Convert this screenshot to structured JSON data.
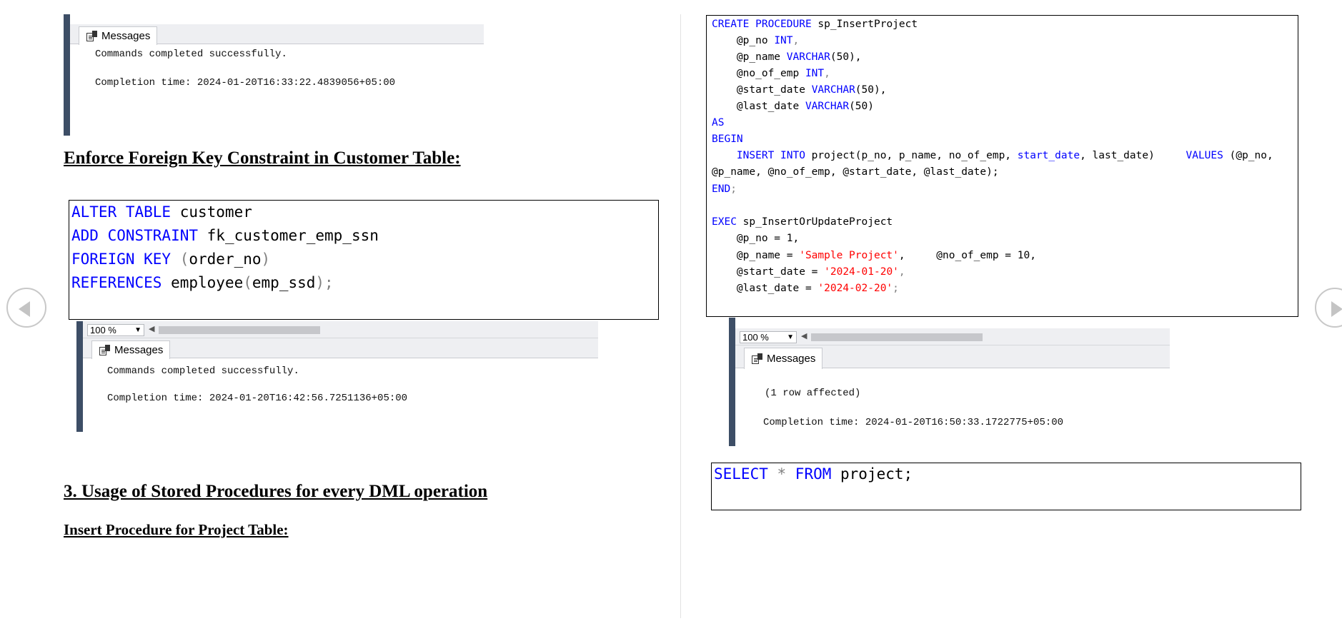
{
  "left": {
    "top_result": {
      "tab_label": "Messages",
      "line1": "Commands completed successfully.",
      "line2": "Completion time: 2024-01-20T16:33:22.4839056+05:00"
    },
    "heading_fk": "Enforce Foreign Key Constraint in Customer Table:",
    "alter_code": {
      "line1_kw": "ALTER TABLE",
      "line1_rest": " customer",
      "line2_kw": "ADD CONSTRAINT",
      "line2_rest": " fk_customer_emp_ssn",
      "line3_kw": "FOREIGN KEY",
      "line3_open": " (",
      "line3_col": "order_no",
      "line3_close": ")",
      "line4_kw": "REFERENCES",
      "line4_tbl": " employee",
      "line4_open": "(",
      "line4_col": "emp_ssd",
      "line4_close": ");"
    },
    "fk_result": {
      "zoom": "100 %",
      "tab_label": "Messages",
      "line1": "Commands completed successfully.",
      "line2": "Completion time: 2024-01-20T16:42:56.7251136+05:00"
    },
    "heading_sp": "3. Usage of Stored Procedures for every DML operation",
    "heading_insert": "Insert Procedure for Project Table:"
  },
  "right": {
    "proc_code": {
      "l1_kw": "CREATE PROCEDURE",
      "l1_rest": " sp_InsertProject",
      "l2_param": "    @p_no ",
      "l2_type": "INT",
      "l2_end": ",",
      "l3_param": "    @p_name ",
      "l3_type": "VARCHAR",
      "l3_end": "(50),",
      "l4_param": "    @no_of_emp ",
      "l4_type": "INT",
      "l4_end": ",",
      "l5_param": "    @start_date ",
      "l5_type": "VARCHAR",
      "l5_end": "(50),",
      "l6_param": "    @last_date ",
      "l6_type": "VARCHAR",
      "l6_end": "(50)",
      "l7_kw": "AS",
      "l8_kw": "BEGIN",
      "l9_kw": "    INSERT INTO",
      "l9_a": " project(p_no, p_name, no_of_emp, ",
      "l9_kw2": "start_date",
      "l9_b": ", last_date)     ",
      "l9_kw3": "VALUES",
      "l9_c": " (@p_no,",
      "l10": "@p_name, @no_of_emp, @start_date, @last_date);",
      "l11_kw": "END",
      "l11_end": ";",
      "l13_kw": "EXEC",
      "l13_rest": " sp_InsertOrUpdateProject",
      "l14": "    @p_no = 1,",
      "l15_a": "    @p_name = ",
      "l15_str": "'Sample Project'",
      "l15_b": ",     @no_of_emp = 10,",
      "l16_a": "    @start_date = ",
      "l16_str": "'2024-01-20'",
      "l16_b": ",",
      "l17_a": "    @last_date = ",
      "l17_str": "'2024-02-20'",
      "l17_b": ";"
    },
    "insert_result": {
      "zoom": "100 %",
      "tab_label": "Messages",
      "line1": "(1 row affected)",
      "line2": "Completion time: 2024-01-20T16:50:33.1722775+05:00"
    },
    "select_code": {
      "kw1": "SELECT",
      "star": " * ",
      "kw2": "FROM",
      "rest": " project;"
    }
  },
  "icons": {
    "prev": "chevron-left-icon",
    "next": "chevron-right-icon",
    "messages": "messages-icon"
  },
  "colors": {
    "keyword": "#0000ff",
    "string": "#ff0000",
    "operator": "#808080",
    "ssms_edge": "#3d4e66"
  }
}
